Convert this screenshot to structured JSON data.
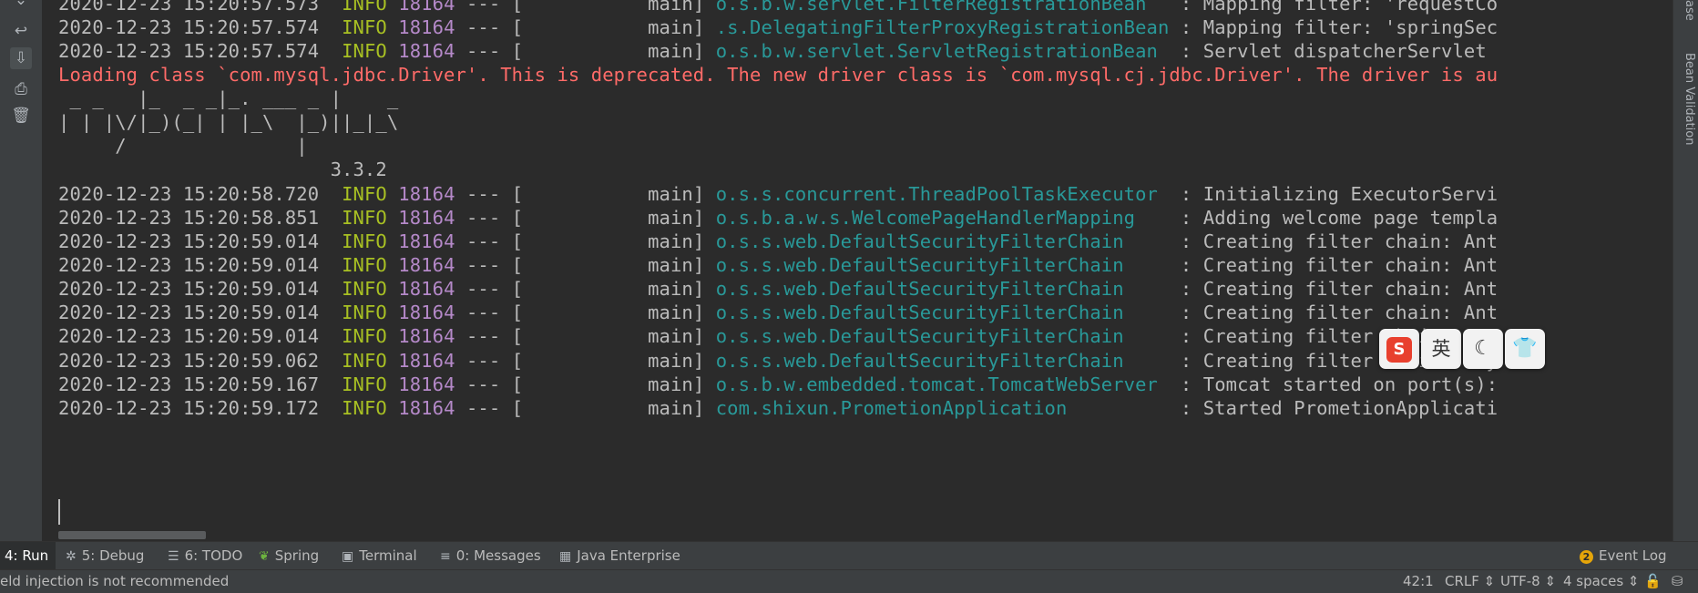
{
  "console": {
    "lines": [
      {
        "time": "2020-12-23 15:20:57.573",
        "level": "INFO",
        "pid": "18164",
        "sep": "--- [",
        "thread": "main]",
        "logger": "o.s.b.w.servlet.FilterRegistrationBean",
        "message": ": Mapping filter: 'requestCo"
      },
      {
        "time": "2020-12-23 15:20:57.574",
        "level": "INFO",
        "pid": "18164",
        "sep": "--- [",
        "thread": "main]",
        "logger": ".s.DelegatingFilterProxyRegistrationBean",
        "message": ": Mapping filter: 'springSec"
      },
      {
        "time": "2020-12-23 15:20:57.574",
        "level": "INFO",
        "pid": "18164",
        "sep": "--- [",
        "thread": "main]",
        "logger": "o.s.b.w.servlet.ServletRegistrationBean",
        "message": ": Servlet dispatcherServlet"
      },
      {
        "time": "2020-12-23 15:20:58.720",
        "level": "INFO",
        "pid": "18164",
        "sep": "--- [",
        "thread": "main]",
        "logger": "o.s.s.concurrent.ThreadPoolTaskExecutor",
        "message": ": Initializing ExecutorServi"
      },
      {
        "time": "2020-12-23 15:20:58.851",
        "level": "INFO",
        "pid": "18164",
        "sep": "--- [",
        "thread": "main]",
        "logger": "o.s.b.a.w.s.WelcomePageHandlerMapping",
        "message": ": Adding welcome page templa"
      },
      {
        "time": "2020-12-23 15:20:59.014",
        "level": "INFO",
        "pid": "18164",
        "sep": "--- [",
        "thread": "main]",
        "logger": "o.s.s.web.DefaultSecurityFilterChain",
        "message": ": Creating filter chain: Ant"
      },
      {
        "time": "2020-12-23 15:20:59.014",
        "level": "INFO",
        "pid": "18164",
        "sep": "--- [",
        "thread": "main]",
        "logger": "o.s.s.web.DefaultSecurityFilterChain",
        "message": ": Creating filter chain: Ant"
      },
      {
        "time": "2020-12-23 15:20:59.014",
        "level": "INFO",
        "pid": "18164",
        "sep": "--- [",
        "thread": "main]",
        "logger": "o.s.s.web.DefaultSecurityFilterChain",
        "message": ": Creating filter chain: Ant"
      },
      {
        "time": "2020-12-23 15:20:59.014",
        "level": "INFO",
        "pid": "18164",
        "sep": "--- [",
        "thread": "main]",
        "logger": "o.s.s.web.DefaultSecurityFilterChain",
        "message": ": Creating filter chain: Ant"
      },
      {
        "time": "2020-12-23 15:20:59.014",
        "level": "INFO",
        "pid": "18164",
        "sep": "--- [",
        "thread": "main]",
        "logger": "o.s.s.web.DefaultSecurityFilterChain",
        "message": ": Creating filter chain: Ant"
      },
      {
        "time": "2020-12-23 15:20:59.062",
        "level": "INFO",
        "pid": "18164",
        "sep": "--- [",
        "thread": "main]",
        "logger": "o.s.s.web.DefaultSecurityFilterChain",
        "message": ": Creating filter chain: any"
      },
      {
        "time": "2020-12-23 15:20:59.167",
        "level": "INFO",
        "pid": "18164",
        "sep": "--- [",
        "thread": "main]",
        "logger": "o.s.b.w.embedded.tomcat.TomcatWebServer",
        "message": ": Tomcat started on port(s):"
      },
      {
        "time": "2020-12-23 15:20:59.172",
        "level": "INFO",
        "pid": "18164",
        "sep": "--- [",
        "thread": "main]",
        "logger": "com.shixun.PrometionApplication",
        "message": ": Started PrometionApplicati"
      }
    ],
    "warning": "Loading class `com.mysql.jdbc.Driver'. This is deprecated. The new driver class is `com.mysql.cj.jdbc.Driver'. The driver is au",
    "banner": [
      " _ _   |_  _ _|_. ___ _ |    _",
      "| | |\\/|_)(_| | |_\\  |_)||_|_\\",
      "     /               |",
      "                        3.3.2"
    ]
  },
  "right_panel": {
    "top_label": "ase",
    "label": "Bean Validation"
  },
  "toolwindow_tabs": [
    {
      "label": "4: Run",
      "icon": "run-icon"
    },
    {
      "label": "5: Debug",
      "icon": "bug-icon"
    },
    {
      "label": "6: TODO",
      "icon": "list-icon"
    },
    {
      "label": "Spring",
      "icon": "spring-leaf-icon"
    },
    {
      "label": "Terminal",
      "icon": "terminal-icon"
    },
    {
      "label": "0: Messages",
      "icon": "messages-icon"
    },
    {
      "label": "Java Enterprise",
      "icon": "java-enterprise-icon"
    }
  ],
  "event_log": {
    "label": "Event Log",
    "badge": "2"
  },
  "status": {
    "message": "eld injection is not recommended",
    "position": "42:1",
    "line_sep": "CRLF ⇕",
    "encoding": "UTF-8 ⇕",
    "indent": "4 spaces ⇕"
  },
  "ime_toolbar": {
    "items": [
      "S",
      "英",
      "☾",
      "👕"
    ]
  }
}
